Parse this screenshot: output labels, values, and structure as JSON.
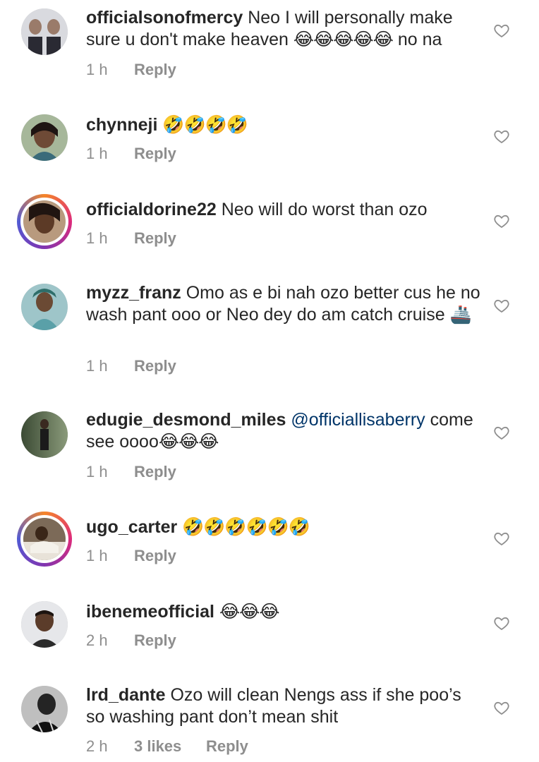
{
  "comments": [
    {
      "username": "officialsonofmercy",
      "text": " Neo I will personally make sure u don't make heaven ",
      "emoji": "😂😂😂😂😂",
      "after": " no na",
      "time": "1 h",
      "reply": "Reply"
    },
    {
      "username": "chynneji",
      "text": " ",
      "emoji": "🤣🤣🤣🤣",
      "after": "",
      "time": "1 h",
      "reply": "Reply"
    },
    {
      "username": "officialdorine22",
      "text": " Neo will do worst than ozo",
      "emoji": "",
      "after": "",
      "time": "1 h",
      "reply": "Reply"
    },
    {
      "username": "myzz_franz",
      "text": " Omo as e bi nah ozo better cus he no wash pant ooo or Neo dey do am catch cruise ",
      "emoji": "🚢",
      "after": "",
      "time": "1 h",
      "reply": "Reply"
    },
    {
      "username": "edugie_desmond_miles",
      "mention": " @officiallisaberry",
      "text": " come see oooo",
      "emoji": "😂😂😂",
      "after": "",
      "time": "1 h",
      "reply": "Reply"
    },
    {
      "username": "ugo_carter",
      "text": " ",
      "emoji": "🤣🤣🤣🤣🤣🤣",
      "after": "",
      "time": "1 h",
      "reply": "Reply"
    },
    {
      "username": "ibenemeofficial",
      "text": " ",
      "emoji": "😂😂😂",
      "after": "",
      "time": "2 h",
      "reply": "Reply"
    },
    {
      "username": "lrd_dante",
      "text": " Ozo will clean Nengs ass if she poo’s so washing pant don’t mean shit",
      "emoji": "",
      "after": "",
      "time": "2 h",
      "likes": "3 likes",
      "reply": "Reply"
    }
  ],
  "colors": {
    "text": "#262626",
    "meta": "#8e8e8e",
    "mention": "#003569",
    "heart": "#8e8e8e"
  },
  "icons": {
    "like": "heart-outline-icon"
  }
}
